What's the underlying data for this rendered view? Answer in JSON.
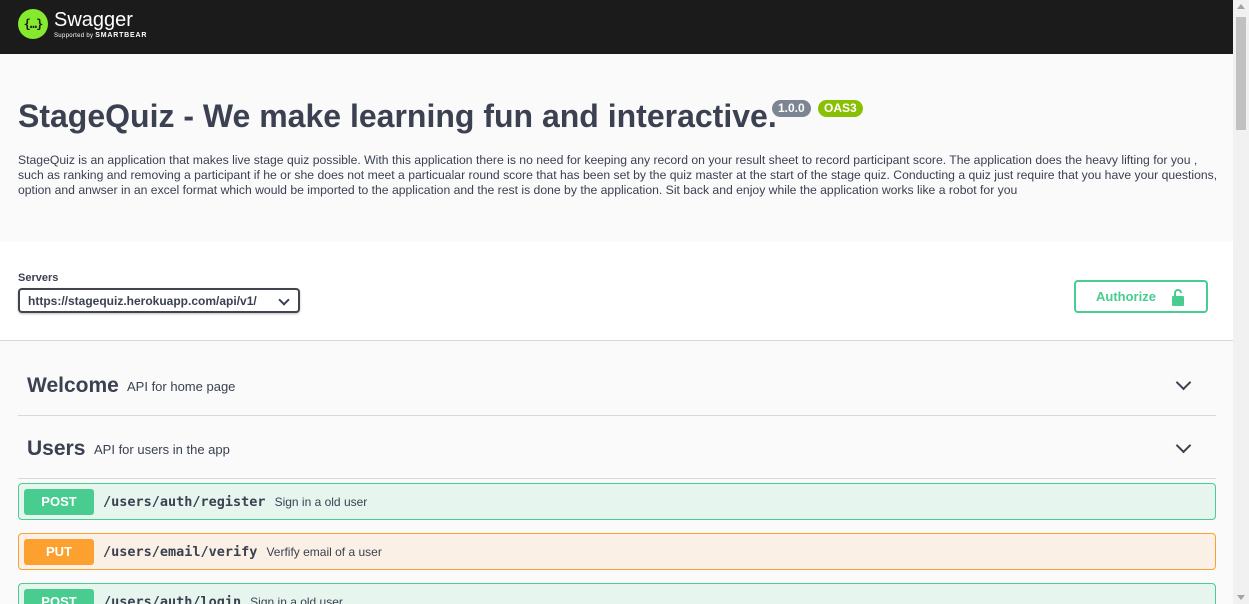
{
  "topbar": {
    "logo_symbol": "{…}",
    "logo_name": "Swagger",
    "logo_sub_prefix": "Supported by",
    "logo_sub_brand": "SMARTBEAR"
  },
  "info": {
    "title": "StageQuiz - We make learning fun and interactive.",
    "version_badge": "1.0.0",
    "oas_badge": "OAS3",
    "description": "StageQuiz is an application that makes live stage quiz possible. With this application there is no need for keeping any record on your result sheet to record participant score. The application does the heavy lifting for you , such as ranking and removing a participant if he or she does not meet a particualar round score that has been set by the quiz master at the start of the stage quiz. Conducting a quiz just require that you have your questions, option and anwser in an excel format which would be imported to the application and the rest is done by the application. Sit back and enjoy while the application works like a robot for you"
  },
  "servers": {
    "label": "Servers",
    "selected": "https://stagequiz.herokuapp.com/api/v1/"
  },
  "authorize": {
    "label": "Authorize",
    "icon": "unlock-icon"
  },
  "tags": [
    {
      "name": "Welcome",
      "description": "API for home page"
    },
    {
      "name": "Users",
      "description": "API for users in the app"
    }
  ],
  "operations": [
    {
      "method": "POST",
      "path": "/users/auth/register",
      "summary": "Sign in a old user"
    },
    {
      "method": "PUT",
      "path": "/users/email/verify",
      "summary": "Verfify email of a user"
    },
    {
      "method": "POST",
      "path": "/users/auth/login",
      "summary": "Sign in a old user"
    }
  ],
  "colors": {
    "topbar": "#1b1b1b",
    "logo": "#85ea2d",
    "post": "#49cc90",
    "put": "#fca130",
    "version_badge": "#7d8492",
    "oas_badge": "#89bf04"
  }
}
